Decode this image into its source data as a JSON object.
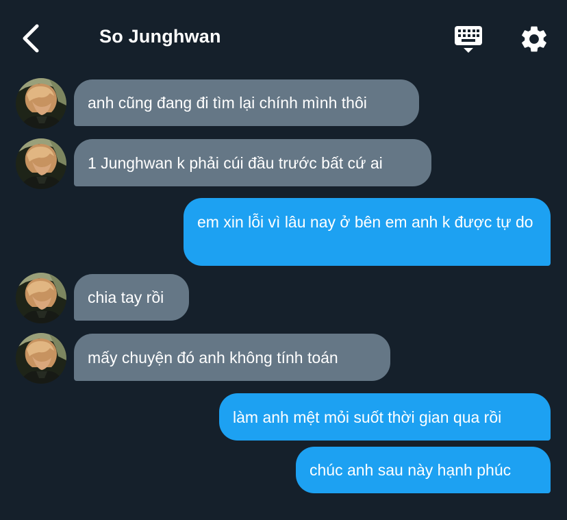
{
  "header": {
    "title": "So Junghwan",
    "back_icon": "chevron-left-icon",
    "keyboard_icon": "keyboard-icon",
    "settings_icon": "gear-icon"
  },
  "colors": {
    "background": "#15202b",
    "incoming_bubble": "#657786",
    "outgoing_bubble": "#1da1f2",
    "text": "#ffffff"
  },
  "messages": [
    {
      "sender": "contact",
      "text": "anh cũng đang đi tìm lại chính mình thôi"
    },
    {
      "sender": "contact",
      "text": "1 Junghwan k phải cúi đầu trước bất cứ ai"
    },
    {
      "sender": "me",
      "text": "em xin lỗi vì lâu nay ở bên em anh k được tự do"
    },
    {
      "sender": "contact",
      "text": "chia tay rồi"
    },
    {
      "sender": "contact",
      "text": "mấy chuyện đó anh không tính toán"
    },
    {
      "sender": "me",
      "text": "làm anh mệt mỏi suốt thời gian qua rồi"
    },
    {
      "sender": "me",
      "text": "chúc anh sau này hạnh phúc"
    }
  ]
}
